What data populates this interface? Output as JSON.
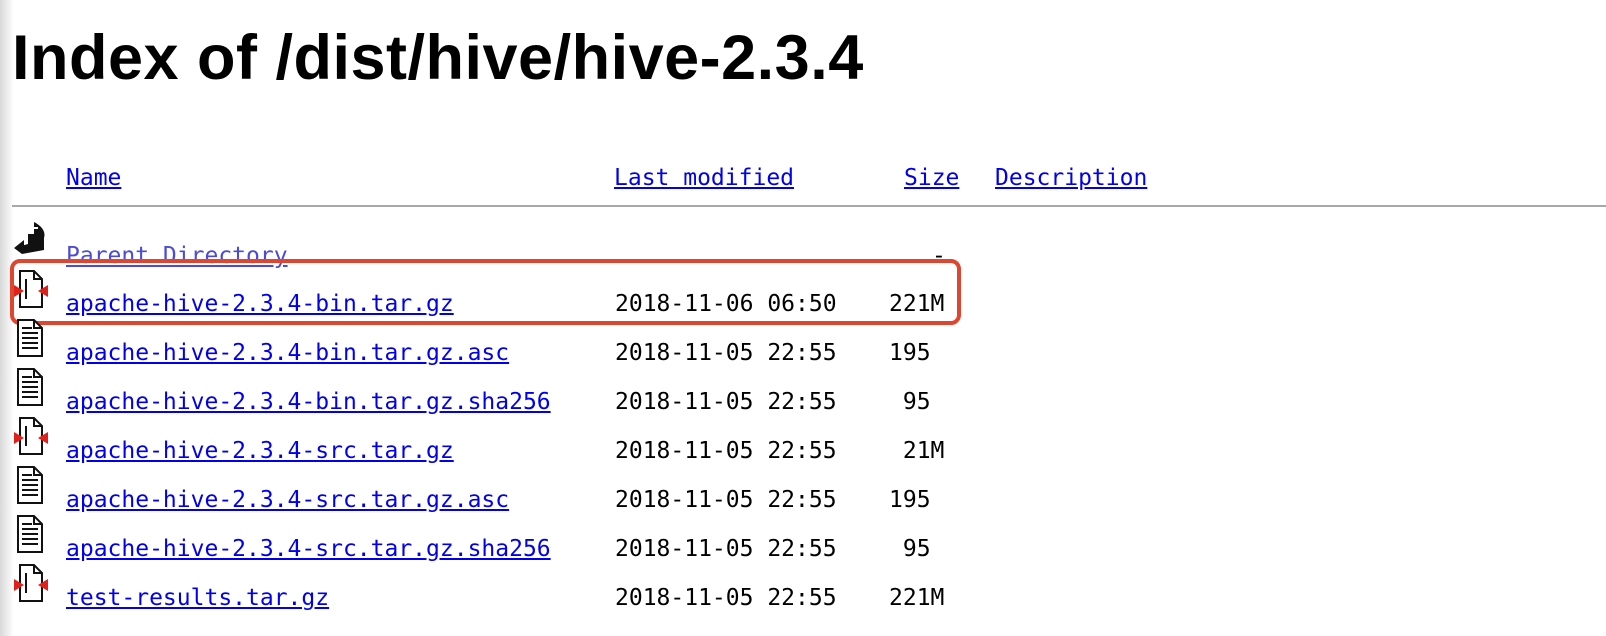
{
  "page": {
    "title": "Index of /dist/hive/hive-2.3.4"
  },
  "headers": {
    "name": "Name",
    "last_modified": "Last modified",
    "size": "Size",
    "description": "Description"
  },
  "parent": {
    "label": "Parent Directory",
    "size": "-",
    "icon": "back-icon"
  },
  "rows": [
    {
      "name": "apache-hive-2.3.4-bin.tar.gz",
      "modified": "2018-11-06 06:50",
      "size": "221M",
      "icon": "compressed-file-icon"
    },
    {
      "name": "apache-hive-2.3.4-bin.tar.gz.asc",
      "modified": "2018-11-05 22:55",
      "size": "195",
      "icon": "text-file-icon"
    },
    {
      "name": "apache-hive-2.3.4-bin.tar.gz.sha256",
      "modified": "2018-11-05 22:55",
      "size": " 95",
      "icon": "text-file-icon"
    },
    {
      "name": "apache-hive-2.3.4-src.tar.gz",
      "modified": "2018-11-05 22:55",
      "size": " 21M",
      "icon": "compressed-file-icon"
    },
    {
      "name": "apache-hive-2.3.4-src.tar.gz.asc",
      "modified": "2018-11-05 22:55",
      "size": "195",
      "icon": "text-file-icon"
    },
    {
      "name": "apache-hive-2.3.4-src.tar.gz.sha256",
      "modified": "2018-11-05 22:55",
      "size": " 95",
      "icon": "text-file-icon"
    },
    {
      "name": "test-results.tar.gz",
      "modified": "2018-11-05 22:55",
      "size": "221M",
      "icon": "compressed-file-icon"
    }
  ],
  "colors": {
    "link": "#0000ee",
    "highlight": "#e0452f",
    "divider": "#a8a8a8"
  }
}
